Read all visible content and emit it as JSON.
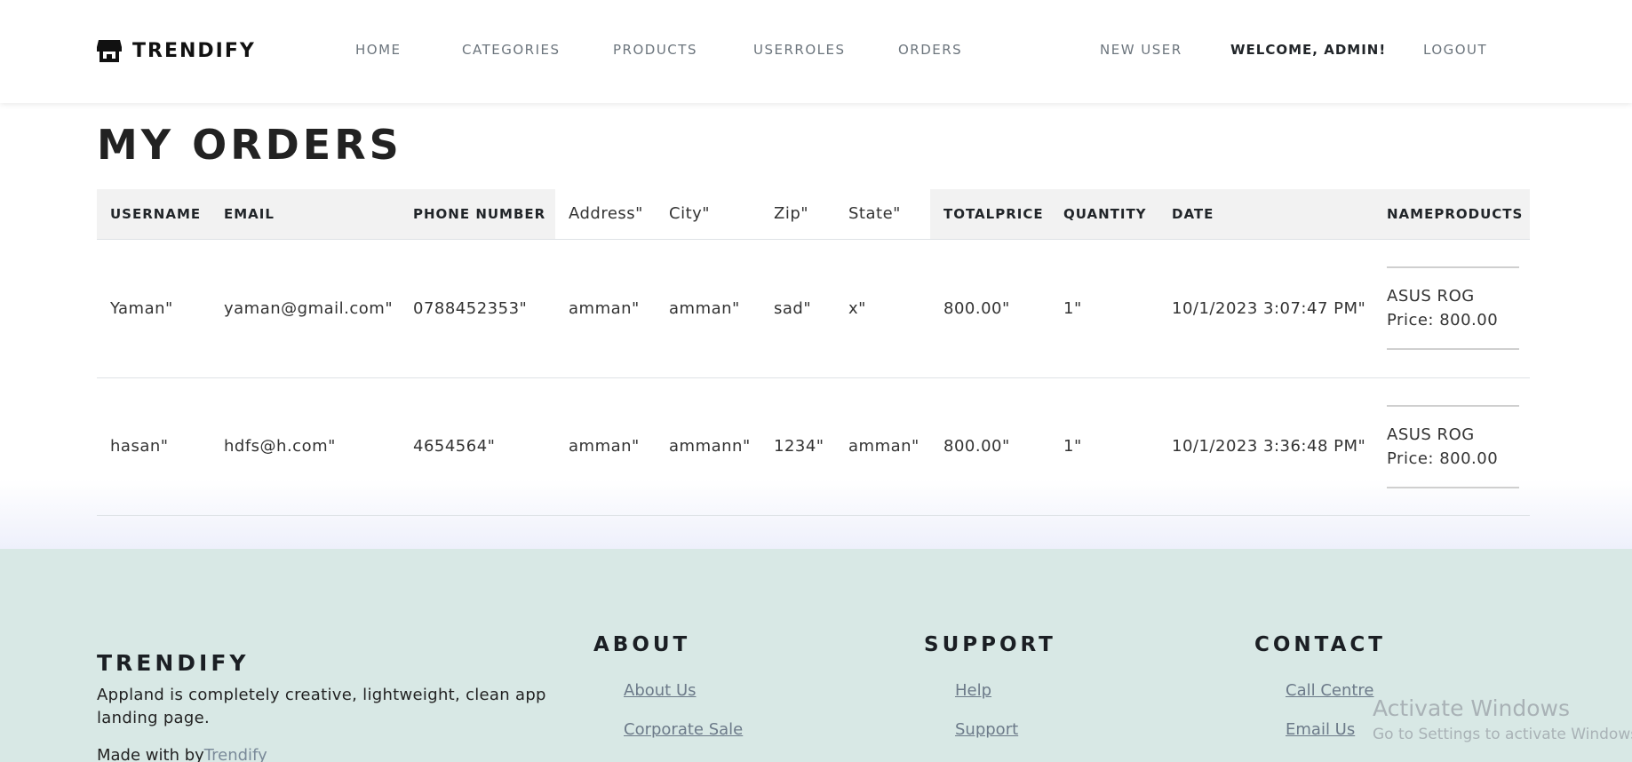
{
  "header": {
    "brand": "TRENDIFY",
    "nav": {
      "home": "HOME",
      "categories": "CATEGORIES",
      "products": "PRODUCTS",
      "userroles": "USERROLES",
      "orders": "ORDERS"
    },
    "new_user": "NEW USER",
    "welcome": "WELCOME, ADMIN!",
    "logout": "LOGOUT"
  },
  "main": {
    "title": "MY ORDERS",
    "columns": [
      "USERNAME",
      "EMAIL",
      "PHONE NUMBER",
      "Address\"",
      "City\"",
      "Zip\"",
      "State\"",
      "TOTALPRICE",
      "QUANTITY",
      "DATE",
      "NAMEPRODUCTS"
    ],
    "rows": [
      {
        "username": "Yaman\"",
        "email": "yaman@gmail.com\"",
        "phone": "0788452353\"",
        "address": "amman\"",
        "city": "amman\"",
        "zip": "sad\"",
        "state": "x\"",
        "total": "800.00\"",
        "quantity": "1\"",
        "date": "10/1/2023 3:07:47 PM\"",
        "product_name": "ASUS ROG",
        "product_price": "Price: 800.00"
      },
      {
        "username": "hasan\"",
        "email": "hdfs@h.com\"",
        "phone": "4654564\"",
        "address": "amman\"",
        "city": "ammann\"",
        "zip": "1234\"",
        "state": "amman\"",
        "total": "800.00\"",
        "quantity": "1\"",
        "date": "10/1/2023 3:36:48 PM\"",
        "product_name": "ASUS ROG",
        "product_price": "Price: 800.00"
      }
    ]
  },
  "footer": {
    "brand": "TRENDIFY",
    "description": "Appland is completely creative, lightweight, clean app landing page.",
    "made_with": "Made with by",
    "made_with_link": "Trendify",
    "about": {
      "title": "ABOUT",
      "links": [
        "About Us",
        "Corporate Sale"
      ]
    },
    "support": {
      "title": "SUPPORT",
      "links": [
        "Help",
        "Support"
      ]
    },
    "contact": {
      "title": "CONTACT",
      "links": [
        "Call Centre",
        "Email Us"
      ]
    }
  },
  "watermark": {
    "title": "Activate Windows",
    "subtitle": "Go to Settings to activate Windows."
  }
}
